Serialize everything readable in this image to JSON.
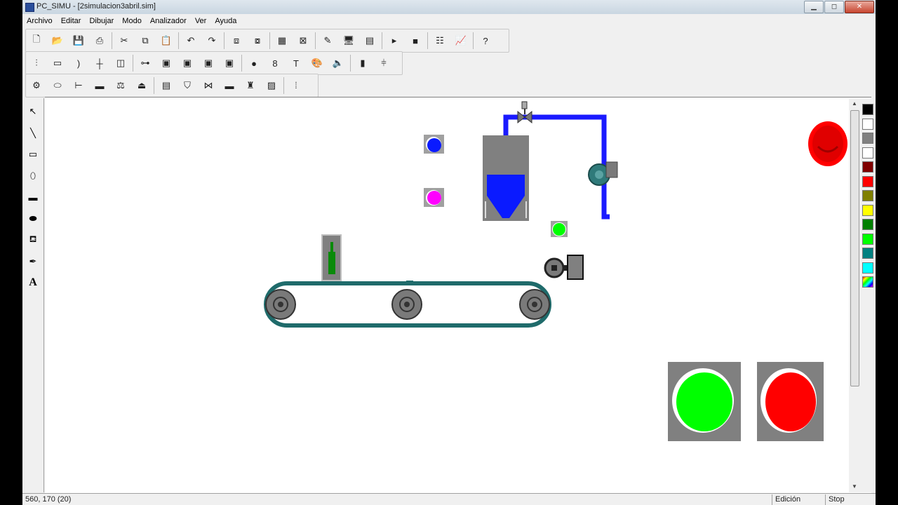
{
  "window": {
    "title": "PC_SIMU - [2simulacion3abril.sim]",
    "controls": {
      "minimize": "▁",
      "maximize": "◻",
      "close": "✕"
    }
  },
  "menu": [
    "Archivo",
    "Editar",
    "Dibujar",
    "Modo",
    "Analizador",
    "Ver",
    "Ayuda"
  ],
  "toolbar1": [
    {
      "name": "new-icon",
      "glyph": "🗋"
    },
    {
      "name": "open-icon",
      "glyph": "📂"
    },
    {
      "name": "save-icon",
      "glyph": "💾"
    },
    {
      "name": "print-icon",
      "glyph": "⎙"
    },
    {
      "name": "cut-icon",
      "glyph": "✂"
    },
    {
      "name": "copy-icon",
      "glyph": "⧉"
    },
    {
      "name": "paste-icon",
      "glyph": "📋"
    },
    {
      "name": "undo-icon",
      "glyph": "↶"
    },
    {
      "name": "redo-icon",
      "glyph": "↷"
    },
    {
      "name": "bring-front-icon",
      "glyph": "⧈"
    },
    {
      "name": "send-back-icon",
      "glyph": "⧇"
    },
    {
      "name": "grid-icon",
      "glyph": "▦"
    },
    {
      "name": "grid-off-icon",
      "glyph": "⊠"
    },
    {
      "name": "edit-pen-icon",
      "glyph": "✎"
    },
    {
      "name": "monitor-icon",
      "glyph": "🖥"
    },
    {
      "name": "plc-icon",
      "glyph": "▤"
    },
    {
      "name": "run-icon",
      "glyph": "▸"
    },
    {
      "name": "stop-icon",
      "glyph": "■"
    },
    {
      "name": "analyzer-icon",
      "glyph": "☷"
    },
    {
      "name": "chart-icon",
      "glyph": "📈"
    },
    {
      "name": "help-icon",
      "glyph": "?"
    }
  ],
  "toolbar2": [
    {
      "name": "switch-icon",
      "glyph": "⫶"
    },
    {
      "name": "rectangle-frame-icon",
      "glyph": "▭"
    },
    {
      "name": "arc-icon",
      "glyph": ")"
    },
    {
      "name": "cross-line-icon",
      "glyph": "┼"
    },
    {
      "name": "double-panel-icon",
      "glyph": "◫"
    },
    {
      "name": "cylinder-icon",
      "glyph": "⊶"
    },
    {
      "name": "display-1-icon",
      "glyph": "▣"
    },
    {
      "name": "display-2-icon",
      "glyph": "▣"
    },
    {
      "name": "display-3-icon",
      "glyph": "▣"
    },
    {
      "name": "display-4-icon",
      "glyph": "▣"
    },
    {
      "name": "led-icon",
      "glyph": "●"
    },
    {
      "name": "digit-display-icon",
      "glyph": "8"
    },
    {
      "name": "text-tool-icon",
      "glyph": "T"
    },
    {
      "name": "palette-icon",
      "glyph": "🎨"
    },
    {
      "name": "speaker-icon",
      "glyph": "🔈"
    },
    {
      "name": "level-bar-icon",
      "glyph": "▮"
    },
    {
      "name": "slider-icon",
      "glyph": "⫩"
    }
  ],
  "toolbar3": [
    {
      "name": "motor-icon",
      "glyph": "⚙"
    },
    {
      "name": "conveyor-tool-icon",
      "glyph": "⬭"
    },
    {
      "name": "piston-icon",
      "glyph": "⊢"
    },
    {
      "name": "cylinder-rod-icon",
      "glyph": "▬"
    },
    {
      "name": "scale-icon",
      "glyph": "⚖"
    },
    {
      "name": "press-icon",
      "glyph": "⏏"
    },
    {
      "name": "tank-tool-icon",
      "glyph": "▤"
    },
    {
      "name": "hopper-tool-icon",
      "glyph": "⛉"
    },
    {
      "name": "valve-tool-icon",
      "glyph": "⋈"
    },
    {
      "name": "pipe-tool-icon",
      "glyph": "▬"
    },
    {
      "name": "bottles-tool-icon",
      "glyph": "♜"
    },
    {
      "name": "hatch-tool-icon",
      "glyph": "▨"
    },
    {
      "name": "bottle-holder-tool-icon",
      "glyph": "⦙"
    }
  ],
  "tools": [
    {
      "name": "select-arrow-icon",
      "glyph": "↖"
    },
    {
      "name": "line-tool-icon",
      "glyph": "╲"
    },
    {
      "name": "rectangle-tool-icon",
      "glyph": "▭"
    },
    {
      "name": "ellipse-tool-icon",
      "glyph": "⬯"
    },
    {
      "name": "filled-rectangle-tool-icon",
      "glyph": "▬"
    },
    {
      "name": "filled-ellipse-tool-icon",
      "glyph": "⬬"
    },
    {
      "name": "fill-bucket-tool-icon",
      "glyph": "⛾"
    },
    {
      "name": "eyedropper-tool-icon",
      "glyph": "✒"
    },
    {
      "name": "text-tool-icon",
      "glyph": "A"
    }
  ],
  "palette": [
    "#000000",
    "#ffffff",
    "#808080",
    "#ffffff",
    "#800000",
    "#ff0000",
    "#808000",
    "#ffff00",
    "#008000",
    "#00ff00",
    "#008080",
    "#00ffff",
    "#rainbow"
  ],
  "status": {
    "coords": "560, 170 (20)",
    "mode": "Edición",
    "run_state": "Stop"
  },
  "colors": {
    "pipe": "#1a1aff",
    "tank": "#808080",
    "liquid": "#0a1aff",
    "belt_edge": "#1f6b6b",
    "roller": "#7a7a7a",
    "start_button": "#00ff00",
    "stop_button": "#ff0000"
  }
}
